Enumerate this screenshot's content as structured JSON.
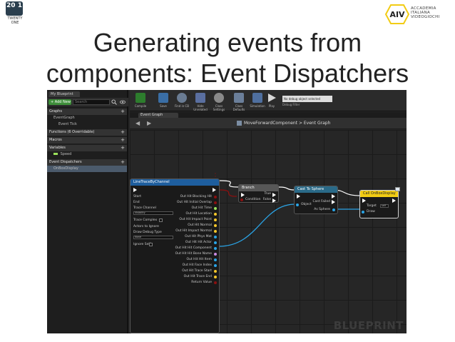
{
  "slide": {
    "title_line1": "Generating events from",
    "title_line2": "components: Event Dispatchers",
    "logo_left": {
      "badge": "20 1",
      "caption": "TWENTY ONE"
    },
    "logo_right": {
      "mark": "AIV",
      "lines": [
        "ACCADEMIA",
        "ITALIANA",
        "VIDEOGIOCHI"
      ]
    }
  },
  "editor": {
    "left_panel": {
      "tab": "My Blueprint",
      "add_button": "+ Add New",
      "search_placeholder": "Search",
      "rows": [
        {
          "label": "Graphs",
          "type": "header",
          "plus": "+"
        },
        {
          "label": "EventGraph",
          "type": "item"
        },
        {
          "label": "Event Tick",
          "type": "item"
        },
        {
          "label": "Functions (6 Overridable)",
          "type": "header",
          "plus": "+"
        },
        {
          "label": "Macros",
          "type": "header",
          "plus": "+"
        },
        {
          "label": "Variables",
          "type": "header",
          "plus": "+"
        },
        {
          "label": "Speed",
          "type": "item"
        },
        {
          "label": "Event Dispatchers",
          "type": "header",
          "plus": "+"
        },
        {
          "label": "OnBoxDisplay",
          "type": "item"
        }
      ]
    },
    "toolbar": {
      "buttons": [
        "Compile",
        "Save",
        "Find in CB",
        "Hide Unrelated",
        "Class Settings",
        "Class Defaults",
        "Simulation",
        "Play"
      ],
      "debug_filter": "No debug object selected",
      "debug_label": "Debug Filter"
    },
    "graph_tab": "Event Graph",
    "breadcrumb": "MoveForwardComponent  >  Event Graph",
    "nodes": {
      "line_trace": {
        "title": "LineTraceByChannel",
        "left_pins": [
          "Start",
          "End",
          "Trace Channel",
          "Visibility",
          "Trace Complex",
          "Actors to Ignore",
          "Draw Debug Type",
          "None",
          "Ignore Self"
        ],
        "right_pins": [
          "Out Hit Blocking Hit",
          "Out Hit Initial Overlap",
          "Out Hit Time",
          "Out Hit Location",
          "Out Hit Impact Point",
          "Out Hit Normal",
          "Out Hit Impact Normal",
          "Out Hit Phys Mat",
          "Out Hit Hit Actor",
          "Out Hit Hit Component",
          "Out Hit Hit Bone Name",
          "Out Hit Hit Item",
          "Out Hit Face Index",
          "Out Hit Trace Start",
          "Out Hit Trace End",
          "Return Value"
        ]
      },
      "branch": {
        "title": "Branch",
        "pins_left": [
          "Condition"
        ],
        "pins_right": [
          "True",
          "False"
        ]
      },
      "cast": {
        "title": "Cast To Sphere",
        "pins_left": [
          "Object"
        ],
        "pins_right": [
          "Cast Failed",
          "As Sphere"
        ]
      },
      "call": {
        "title": "Call OnBoxDisplay",
        "pins_left": [
          "Target",
          "Draw"
        ],
        "target_value": "self"
      }
    },
    "watermark": "BLUEPRINT"
  },
  "colors": {
    "exec_white": "#ffffff",
    "bool_red": "#8b1010",
    "object_blue": "#2aa4e6",
    "struct_blue": "#1e5e9e",
    "vector_yellow": "#f4c62b",
    "float_green": "#9be25b",
    "name_pink": "#c98ae0",
    "addbtn_green": "#3e8e3a",
    "brand_yellow": "#f2cc14"
  }
}
